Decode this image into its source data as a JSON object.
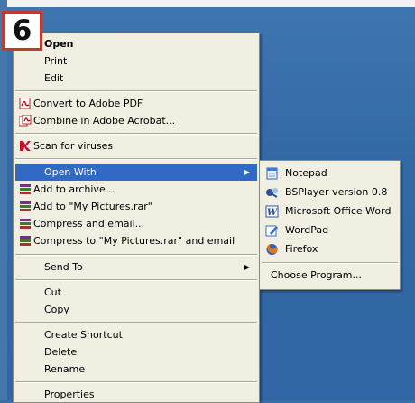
{
  "step_number": "6",
  "context_menu": {
    "open": "Open",
    "print": "Print",
    "edit": "Edit",
    "convert_pdf": "Convert to Adobe PDF",
    "combine_acrobat": "Combine in Adobe Acrobat...",
    "scan_viruses": "Scan for viruses",
    "open_with": "Open With",
    "add_archive": "Add to archive...",
    "add_rar": "Add to \"My Pictures.rar\"",
    "compress_email": "Compress and email...",
    "compress_rar_email": "Compress to \"My Pictures.rar\" and email",
    "send_to": "Send To",
    "cut": "Cut",
    "copy": "Copy",
    "create_shortcut": "Create Shortcut",
    "delete": "Delete",
    "rename": "Rename",
    "properties": "Properties"
  },
  "open_with_submenu": {
    "notepad": "Notepad",
    "bsplayer": "BSPlayer version 0.8",
    "word": "Microsoft Office Word",
    "wordpad": "WordPad",
    "firefox": "Firefox",
    "choose": "Choose Program..."
  },
  "colors": {
    "highlight": "#316ac5",
    "menu_bg": "#f1efe2",
    "badge_border": "#c23a2b",
    "desktop": "#3a6ea5"
  },
  "icons": [
    "pdf-icon",
    "acrobat-icon",
    "antivirus-icon",
    "winrar-icon",
    "notepad-icon",
    "bsplayer-icon",
    "word-icon",
    "wordpad-icon",
    "firefox-icon"
  ]
}
